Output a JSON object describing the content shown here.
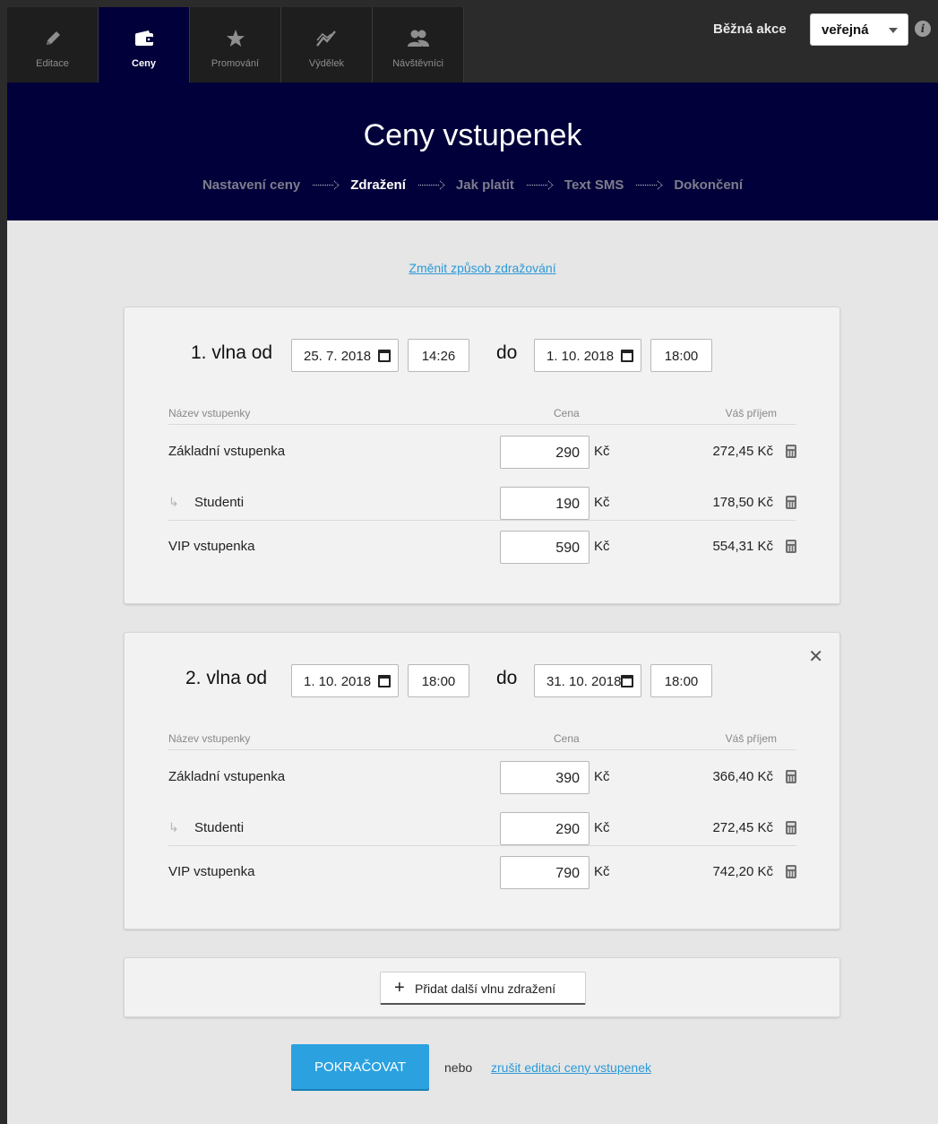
{
  "nav": {
    "tabs": [
      {
        "label": "Editace",
        "icon": "pencil-icon"
      },
      {
        "label": "Ceny",
        "icon": "wallet-icon"
      },
      {
        "label": "Promování",
        "icon": "star-icon"
      },
      {
        "label": "Výdělek",
        "icon": "chart-line-icon"
      },
      {
        "label": "Návštěvníci",
        "icon": "users-icon"
      }
    ],
    "active_tab": "Ceny",
    "event_type": "Běžná akce",
    "visibility": "veřejná"
  },
  "header": {
    "title": "Ceny vstupenek",
    "steps": [
      "Nastavení ceny",
      "Zdražení",
      "Jak platit",
      "Text SMS",
      "Dokončení"
    ],
    "current_step": "Zdražení"
  },
  "change_link": "Změnit způsob zdražování",
  "table_headers": {
    "name": "Název vstupenky",
    "price": "Cena",
    "income": "Váš příjem"
  },
  "currency": "Kč",
  "to_label": "do",
  "waves": [
    {
      "label": "1. vlna od",
      "from_date": "25. 7. 2018",
      "from_time": "14:26",
      "to_date": "1. 10. 2018",
      "to_time": "18:00",
      "rows": [
        {
          "name": "Základní vstupenka",
          "price": "290",
          "income": "272,45 Kč"
        },
        {
          "name": "Studenti",
          "price": "190",
          "income": "178,50 Kč"
        },
        {
          "name": "VIP vstupenka",
          "price": "590",
          "income": "554,31 Kč"
        }
      ]
    },
    {
      "label": "2. vlna od",
      "from_date": "1. 10. 2018",
      "from_time": "18:00",
      "to_date": "31. 10. 2018",
      "to_time": "18:00",
      "rows": [
        {
          "name": "Základní vstupenka",
          "price": "390",
          "income": "366,40 Kč"
        },
        {
          "name": "Studenti",
          "price": "290",
          "income": "272,45 Kč"
        },
        {
          "name": "VIP vstupenka",
          "price": "790",
          "income": "742,20 Kč"
        }
      ]
    }
  ],
  "add_wave_label": "Přidat další vlnu zdražení",
  "continue_label": "POKRAČOVAT",
  "or_label": "nebo",
  "cancel_label": "zrušit editaci ceny vstupenek",
  "colors": {
    "header_bg": "#02003a",
    "accent": "#2ba1e0",
    "link": "#2a9ad8"
  }
}
